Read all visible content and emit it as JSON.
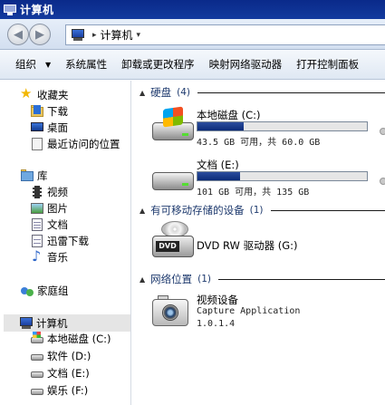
{
  "window": {
    "title": "计算机"
  },
  "address": {
    "crumb": "计算机",
    "separator": "▸"
  },
  "toolbar": {
    "items": [
      {
        "label": "组织",
        "dropdown": true
      },
      {
        "label": "系统属性"
      },
      {
        "label": "卸载或更改程序"
      },
      {
        "label": "映射网络驱动器"
      },
      {
        "label": "打开控制面板"
      }
    ]
  },
  "sidebar": {
    "favorites": {
      "label": "收藏夹",
      "items": [
        "下载",
        "桌面",
        "最近访问的位置"
      ]
    },
    "libraries": {
      "label": "库",
      "items": [
        "视频",
        "图片",
        "文档",
        "迅雷下载",
        "音乐"
      ]
    },
    "homegroup": {
      "label": "家庭组"
    },
    "computer": {
      "label": "计算机",
      "drives": [
        "本地磁盘 (C:)",
        "软件 (D:)",
        "文档 (E:)",
        "娱乐 (F:)"
      ]
    }
  },
  "main": {
    "groups": {
      "harddisks": {
        "label": "硬盘",
        "count": "(4)"
      },
      "removable": {
        "label": "有可移动存储的设备",
        "count": "(1)"
      },
      "network": {
        "label": "网络位置",
        "count": "(1)"
      }
    },
    "drives": [
      {
        "name": "本地磁盘 (C:)",
        "info": "43.5 GB 可用，共 60.0 GB",
        "used_fraction": 0.275
      },
      {
        "name": "文档 (E:)",
        "info": "101 GB 可用，共 135 GB",
        "used_fraction": 0.25
      }
    ],
    "dvd": {
      "name": "DVD RW 驱动器 (G:)",
      "badge": "DVD"
    },
    "device": {
      "name": "视频设备",
      "line2": "Capture Application",
      "line3": "1.0.1.4"
    }
  },
  "colors": {
    "titlebar": "#0a2a8a",
    "usage_bar": "#0b2a78"
  },
  "icons": {
    "favorites": "star-icon",
    "downloads": "download-folder-icon",
    "desktop": "desktop-icon",
    "recent": "recent-places-icon",
    "library": "library-icon",
    "video": "video-library-icon",
    "pictures": "pictures-library-icon",
    "documents": "documents-library-icon",
    "thunder": "thunder-download-icon",
    "music": "music-library-icon",
    "homegroup": "homegroup-icon",
    "computer": "computer-icon",
    "drive": "drive-icon",
    "dvd": "dvd-drive-icon",
    "camera": "camera-icon"
  }
}
